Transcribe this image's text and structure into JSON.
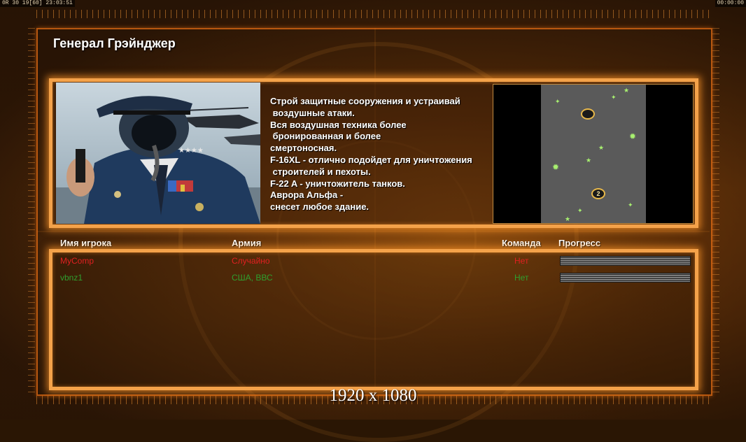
{
  "status": {
    "left_text": "0R 30 19[60] 23:03:51",
    "right_text": "00:00:00"
  },
  "general": {
    "title": "Генерал Грэйнджер",
    "description_lines": [
      "Строй защитные сооружения и устраивай",
      " воздушные атаки.",
      "Вся воздушная техника более",
      " бронированная и более",
      "смертоносная.",
      "F-16XL - отлично подойдет для уничтожения",
      " строителей и пехоты.",
      "F-22 A - уничтожитель танков.",
      "Аврора Альфа -",
      "снесет любое здание."
    ]
  },
  "minimap": {
    "start_positions": [
      "",
      "2"
    ]
  },
  "table": {
    "headers": {
      "player": "Имя игрока",
      "army": "Армия",
      "team": "Команда",
      "progress": "Прогресс"
    },
    "rows": [
      {
        "player": "MyComp",
        "army": "Случайно",
        "team": "Нет",
        "color": "#e02020",
        "progress": 1.0
      },
      {
        "player": "vbnz1",
        "army": "США, ВВС",
        "team": "Нет",
        "color": "#2fa02f",
        "progress": 1.0
      }
    ]
  },
  "resolution": "1920 x 1080"
}
